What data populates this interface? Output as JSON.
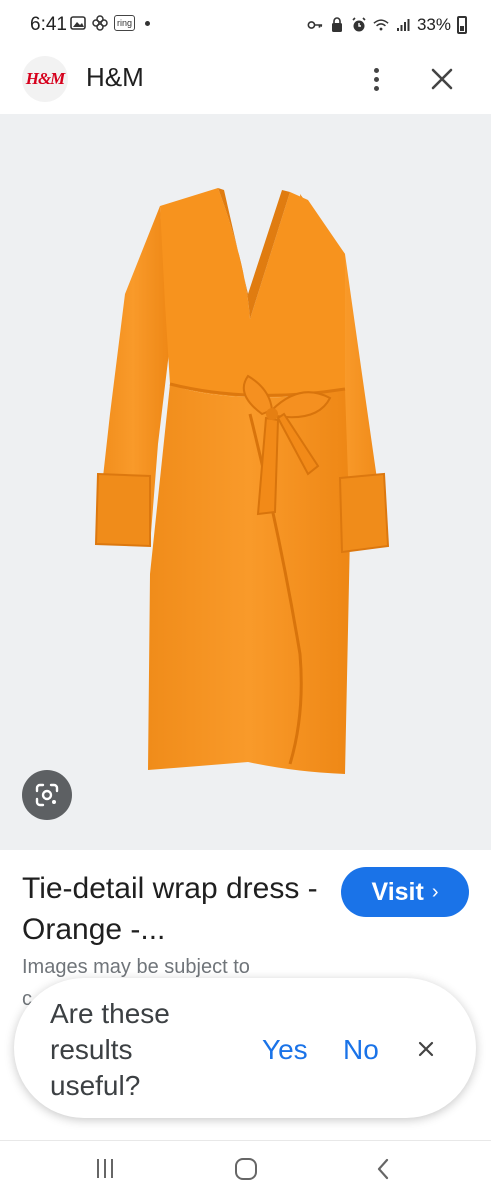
{
  "status_bar": {
    "time": "6:41",
    "ring_badge": "ring",
    "battery": "33%"
  },
  "header": {
    "logo_text": "H&M",
    "site_name": "H&M"
  },
  "product": {
    "title": "Tie-detail wrap dress - Orange -...",
    "visit_label": "Visit",
    "disclaimer": "Images may be subject to",
    "disclaimer_cut": "c",
    "dress_color": "#f7931e"
  },
  "feedback": {
    "question": "Are these results useful?",
    "yes": "Yes",
    "no": "No"
  },
  "colors": {
    "accent": "#1a73e8",
    "brand_red": "#d6001c",
    "image_bg": "#eef0f2"
  }
}
